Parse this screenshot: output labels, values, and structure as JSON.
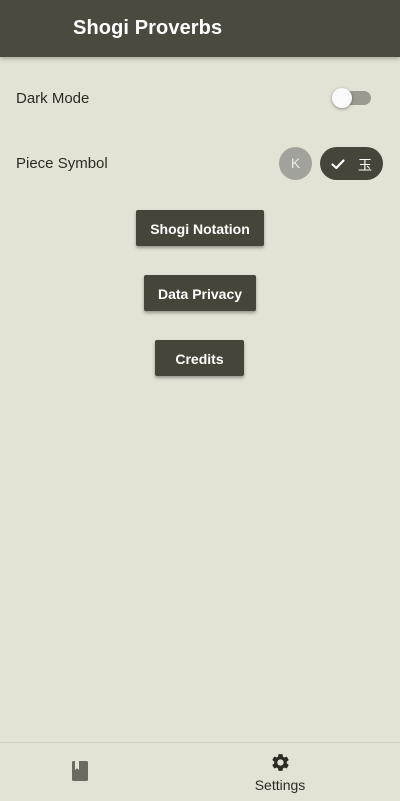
{
  "app_bar": {
    "title": "Shogi Proverbs"
  },
  "settings": {
    "dark_mode": {
      "label": "Dark Mode",
      "enabled": false
    },
    "piece_symbol": {
      "label": "Piece Symbol",
      "options": [
        {
          "label": "K",
          "selected": false
        },
        {
          "label": "玉",
          "selected": true
        }
      ]
    }
  },
  "buttons": {
    "notation": "Shogi Notation",
    "privacy": "Data Privacy",
    "credits": "Credits"
  },
  "bottom_nav": {
    "items": [
      {
        "icon": "book-icon",
        "label": "",
        "active": false
      },
      {
        "icon": "gear-icon",
        "label": "Settings",
        "active": true
      }
    ]
  },
  "colors": {
    "background": "#e3e3d5",
    "app_bar": "#4a4a3f",
    "accent": "#45453a"
  }
}
